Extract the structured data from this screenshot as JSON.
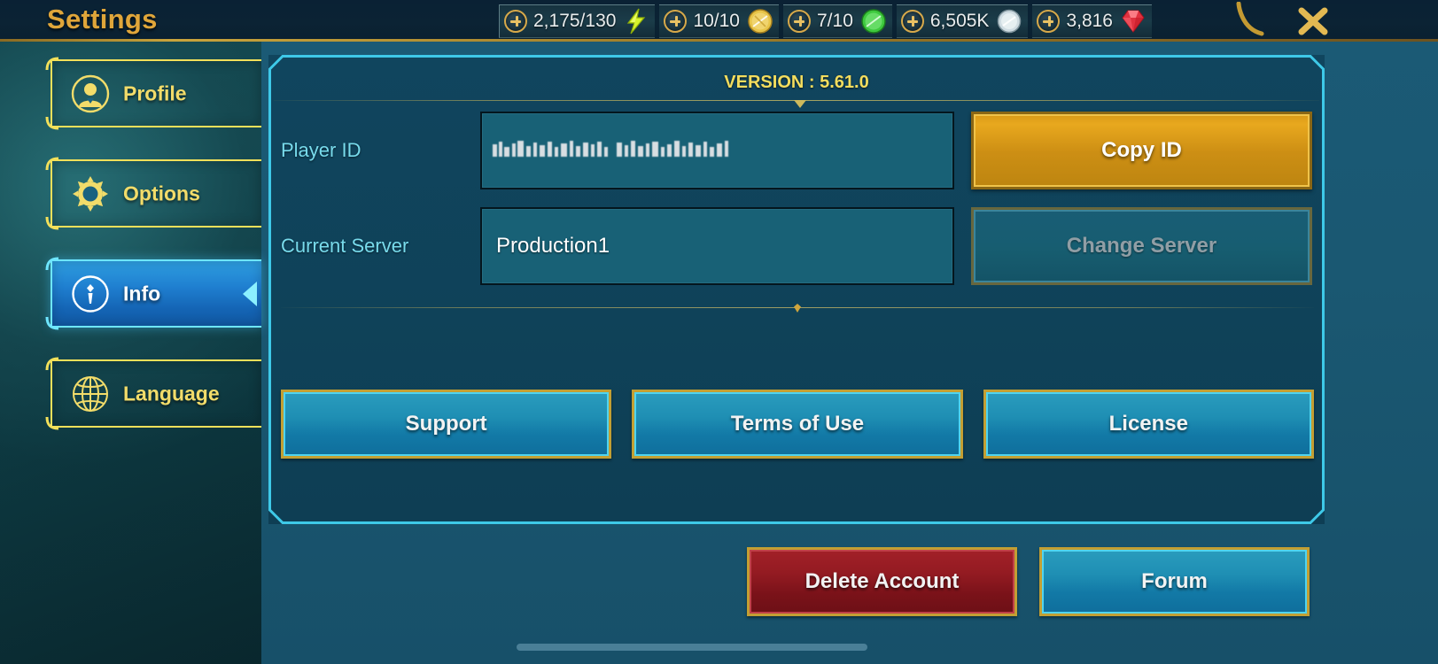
{
  "window": {
    "title": "Settings",
    "close_icon": "close-x-icon"
  },
  "topbar": {
    "resources": [
      {
        "name": "stamina",
        "value": "2,175/130",
        "icon": "lightning-bolt-icon",
        "plus_label": "+"
      },
      {
        "name": "gold-coin",
        "value": "10/10",
        "icon": "gold-coin-icon",
        "plus_label": "+"
      },
      {
        "name": "green-coin",
        "value": "7/10",
        "icon": "green-coin-icon",
        "plus_label": "+"
      },
      {
        "name": "silver-coin",
        "value": "6,505K",
        "icon": "silver-coin-icon",
        "plus_label": "+"
      },
      {
        "name": "gems",
        "value": "3,816",
        "icon": "red-gem-icon",
        "plus_label": "+"
      }
    ]
  },
  "sidebar": {
    "items": [
      {
        "label": "Profile",
        "icon": "user-avatar-icon",
        "active": false
      },
      {
        "label": "Options",
        "icon": "gear-icon",
        "active": false
      },
      {
        "label": "Info",
        "icon": "info-circle-icon",
        "active": true
      },
      {
        "label": "Language",
        "icon": "globe-icon",
        "active": false
      }
    ]
  },
  "panel": {
    "version_text": "VERSION : 5.61.0",
    "fields": [
      {
        "label": "Player ID",
        "value": "",
        "censored": true,
        "action": {
          "label": "Copy ID",
          "style": "gold",
          "disabled": false
        }
      },
      {
        "label": "Current Server",
        "value": "Production1",
        "censored": false,
        "action": {
          "label": "Change Server",
          "style": "disabled",
          "disabled": true
        }
      }
    ],
    "links": [
      {
        "label": "Support"
      },
      {
        "label": "Terms of Use"
      },
      {
        "label": "License"
      }
    ]
  },
  "bottom_actions": [
    {
      "label": "Delete Account",
      "style": "danger"
    },
    {
      "label": "Forum",
      "style": "primary"
    }
  ],
  "colors": {
    "accent_gold": "#e0a63a",
    "label_cyan": "#78dbec",
    "panel_border": "#3ec9e8",
    "active_blue": "#1f7fd0",
    "danger_red": "#941b22",
    "version_yellow": "#f3dd5e"
  }
}
